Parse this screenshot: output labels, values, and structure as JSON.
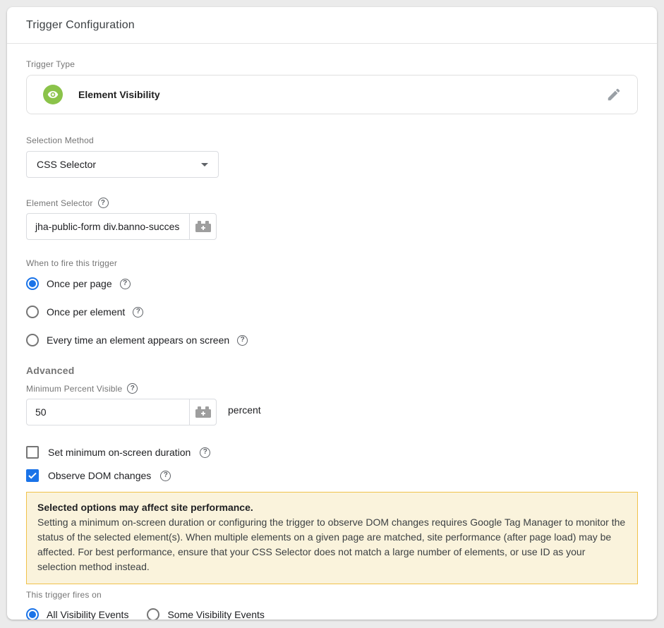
{
  "header": {
    "title": "Trigger Configuration"
  },
  "trigger_type": {
    "label": "Trigger Type",
    "value": "Element Visibility"
  },
  "selection_method": {
    "label": "Selection Method",
    "value": "CSS Selector"
  },
  "element_selector": {
    "label": "Element Selector",
    "value": "jha-public-form div.banno-succes"
  },
  "fire_trigger": {
    "label": "When to fire this trigger",
    "options": [
      {
        "label": "Once per page",
        "selected": true
      },
      {
        "label": "Once per element",
        "selected": false
      },
      {
        "label": "Every time an element appears on screen",
        "selected": false
      }
    ]
  },
  "advanced": {
    "title": "Advanced",
    "min_percent": {
      "label": "Minimum Percent Visible",
      "value": "50",
      "unit": "percent"
    },
    "checkboxes": [
      {
        "label": "Set minimum on-screen duration",
        "checked": false
      },
      {
        "label": "Observe DOM changes",
        "checked": true
      }
    ]
  },
  "warning": {
    "title": "Selected options may affect site performance.",
    "body": "Setting a minimum on-screen duration or configuring the trigger to observe DOM changes requires Google Tag Manager to monitor the status of the selected element(s). When multiple elements on a given page are matched, site performance (after page load) may be affected. For best performance, ensure that your CSS Selector does not match a large number of elements, or use ID as your selection method instead."
  },
  "fires_on": {
    "label": "This trigger fires on",
    "options": [
      {
        "label": "All Visibility Events",
        "selected": true
      },
      {
        "label": "Some Visibility Events",
        "selected": false
      }
    ]
  },
  "icons": {
    "help": "?"
  },
  "colors": {
    "accent_blue": "#1A73E8",
    "icon_green": "#8BC34A",
    "warning_bg": "#FAF3DC",
    "warning_border": "#F0C24B"
  }
}
